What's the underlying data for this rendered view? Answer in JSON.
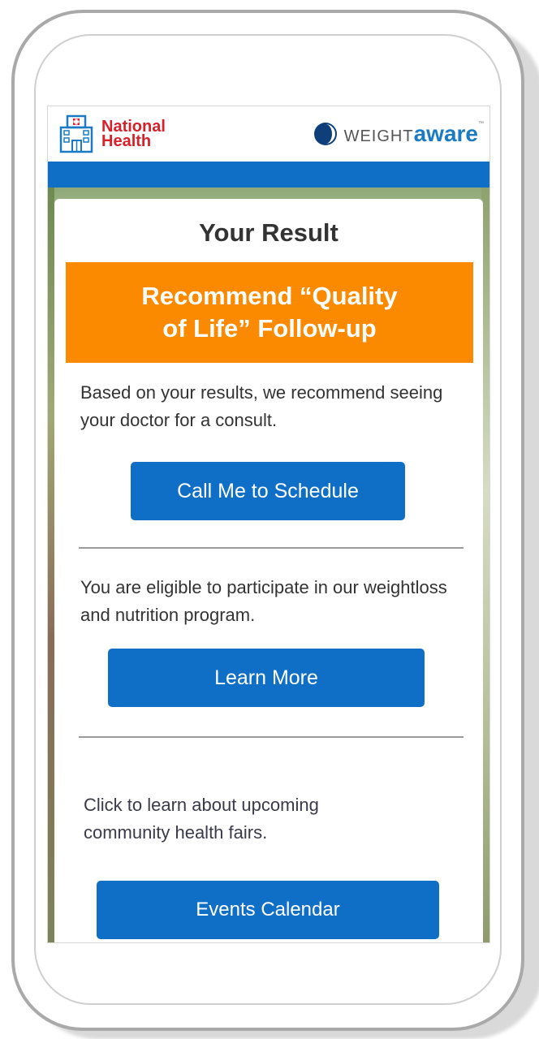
{
  "header": {
    "hospital_name_line1": "National",
    "hospital_name_line2": "Health",
    "brand_light": "WEIGHT",
    "brand_bold": "aware",
    "brand_tm": "™"
  },
  "result": {
    "title": "Your Result",
    "banner_line1": "Recommend “Quality",
    "banner_line2": "of Life” Follow-up"
  },
  "sections": [
    {
      "text": "Based on your results, we recommend seeing your doctor for a consult.",
      "button": "Call Me to Schedule"
    },
    {
      "text": "You are eligible to participate in our weightloss and nutrition program.",
      "button": "Learn More"
    },
    {
      "text": "Click to learn about upcoming community health fairs.",
      "button": "Events Calendar"
    }
  ],
  "colors": {
    "primary_blue": "#0f6fc6",
    "banner_orange": "#fb8a00",
    "hospital_red": "#d81f2a"
  }
}
